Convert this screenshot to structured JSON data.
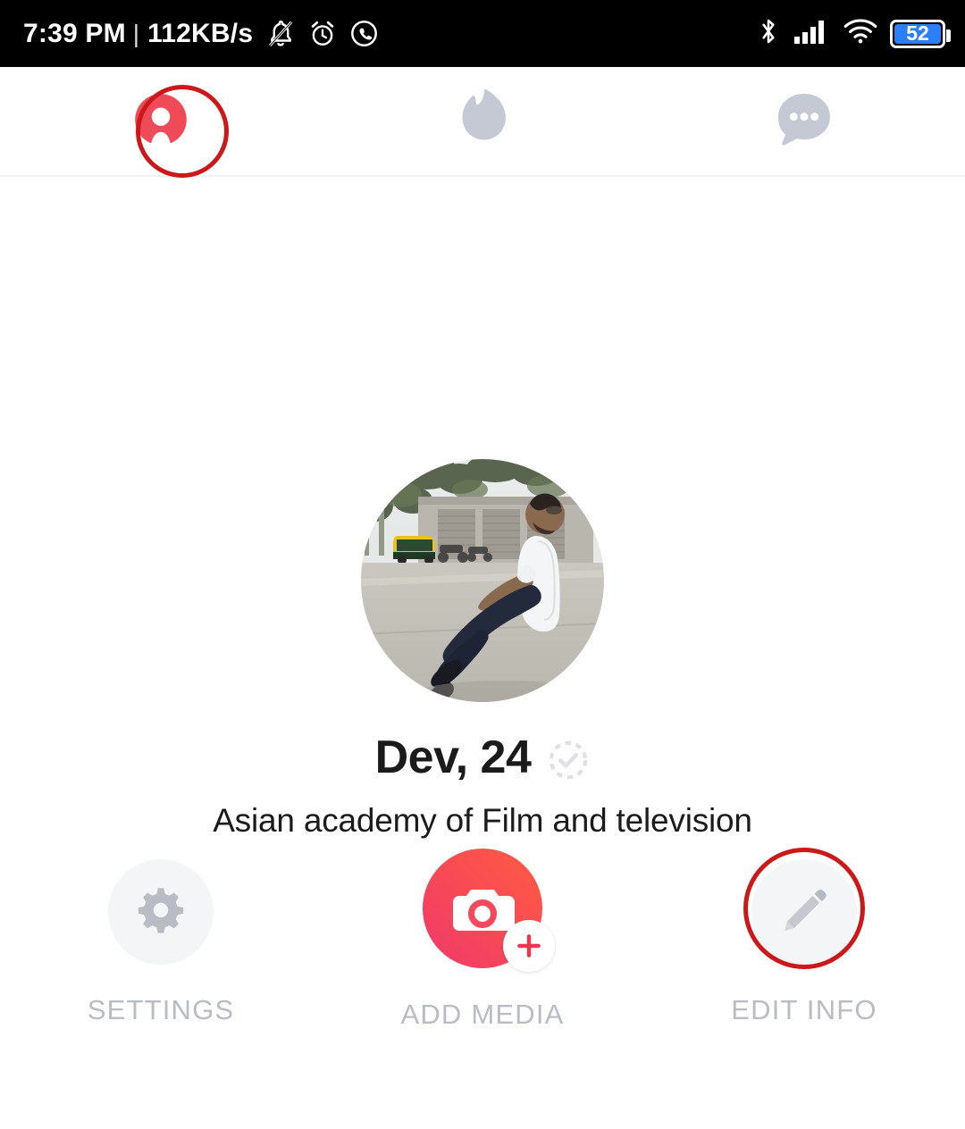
{
  "status_bar": {
    "time": "7:39 PM",
    "separator": "|",
    "network_speed": "112KB/s",
    "left_icons": [
      "bell-muted-icon",
      "alarm-clock-icon",
      "whatsapp-icon"
    ],
    "right_icons": [
      "bluetooth-icon",
      "cellular-signal-icon",
      "wifi-icon"
    ],
    "battery_level": "52",
    "battery_color": "#2d7ff9",
    "background": "#000000",
    "foreground": "#ffffff"
  },
  "top_nav": {
    "tabs": [
      {
        "name": "profile",
        "icon": "profile-person-icon",
        "active": true,
        "color": "#ef4a58"
      },
      {
        "name": "discover",
        "icon": "tinder-flame-icon",
        "active": false,
        "color": "#c5c9d3"
      },
      {
        "name": "messages",
        "icon": "chat-bubble-icon",
        "active": false,
        "color": "#c5c9d3"
      }
    ]
  },
  "profile": {
    "avatar_alt": "man in white shirt sitting on pavement",
    "name_age": "Dev, 24",
    "verification_badge": "check-circle-dashed-icon",
    "tagline": "Asian academy of Film and television"
  },
  "actions": [
    {
      "id": "settings",
      "label": "SETTINGS",
      "icon": "gear-icon",
      "icon_color": "#b9bcc4",
      "circle_color": "#f4f5f7"
    },
    {
      "id": "add_media",
      "label": "ADD MEDIA",
      "icon": "camera-icon",
      "badge_icon": "plus-icon",
      "gradient_from": "#f0386b",
      "gradient_to": "#ff5c41"
    },
    {
      "id": "edit_info",
      "label": "EDIT INFO",
      "icon": "pencil-icon",
      "icon_color": "#c5c8cf",
      "circle_color": "#f4f5f7"
    }
  ],
  "annotations": [
    {
      "target": "profile-tab",
      "shape": "circle",
      "color": "#cc1818"
    },
    {
      "target": "edit-info-button",
      "shape": "circle",
      "color": "#cc1818"
    }
  ]
}
